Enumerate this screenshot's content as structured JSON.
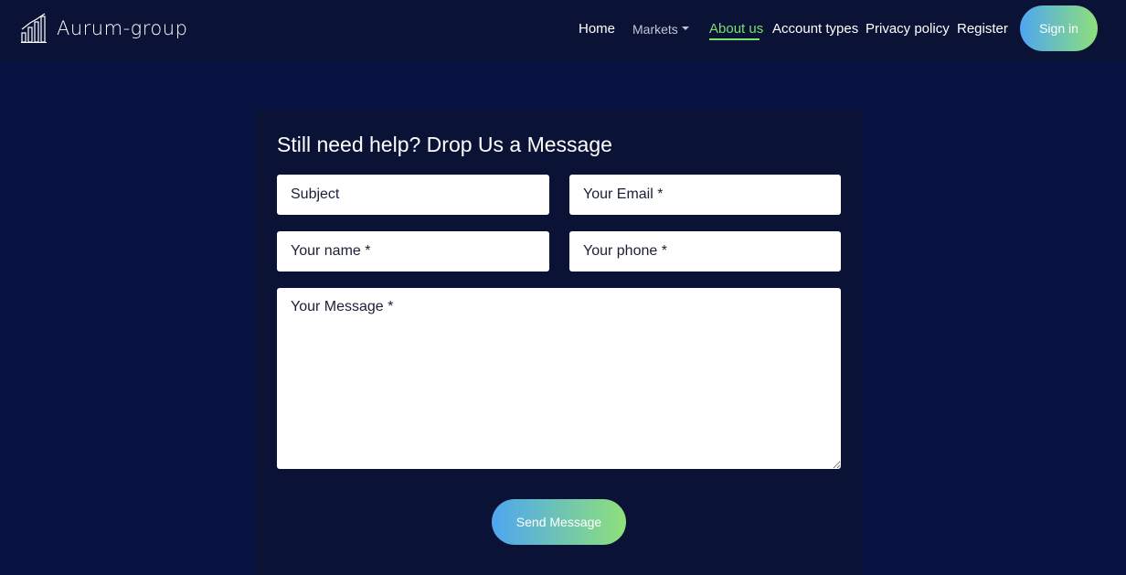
{
  "brand": {
    "name": "Aurum-group",
    "icon": "bar-chart-logo-icon"
  },
  "nav": {
    "items": [
      {
        "label": "Home"
      },
      {
        "label": "Markets"
      },
      {
        "label": "About us"
      },
      {
        "label": "Account types"
      },
      {
        "label": "Privacy policy"
      },
      {
        "label": "Register"
      }
    ],
    "signin_label": "Sign in"
  },
  "form": {
    "title": "Still need help? Drop Us a Message",
    "subject_placeholder": "Subject",
    "email_placeholder": "Your Email *",
    "name_placeholder": "Your name *",
    "phone_placeholder": "Your phone *",
    "message_placeholder": "Your Message *",
    "send_label": "Send Message"
  },
  "colors": {
    "page_background": "#081240",
    "header_background": "#0a1235",
    "active_link": "#7ae06e",
    "button_gradient_start": "#4ea6f0",
    "button_gradient_end": "#8ee07a"
  }
}
